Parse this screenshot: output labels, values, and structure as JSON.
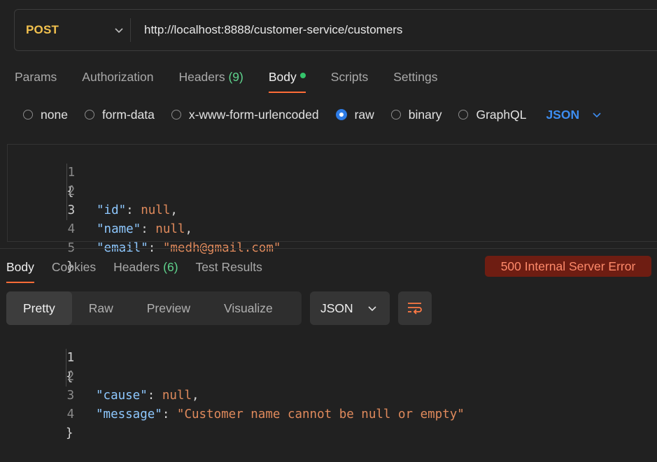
{
  "request": {
    "method": "POST",
    "url": "http://localhost:8888/customer-service/customers",
    "tabs": [
      {
        "label": "Params"
      },
      {
        "label": "Authorization"
      },
      {
        "label": "Headers",
        "count": "(9)"
      },
      {
        "label": "Body",
        "active": true
      },
      {
        "label": "Scripts"
      },
      {
        "label": "Settings"
      }
    ],
    "body_types": [
      "none",
      "form-data",
      "x-www-form-urlencoded",
      "raw",
      "binary",
      "GraphQL"
    ],
    "selected_body_type": "raw",
    "format": "JSON",
    "code_lines": [
      {
        "n": "1",
        "text": "{"
      },
      {
        "n": "2",
        "key": "\"id\"",
        "value": "null",
        "trail": ","
      },
      {
        "n": "3",
        "key": "\"name\"",
        "value": "null",
        "trail": ","
      },
      {
        "n": "4",
        "key": "\"email\"",
        "value": "\"medh@gmail.com\"",
        "trail": ""
      },
      {
        "n": "5",
        "text": "}"
      }
    ]
  },
  "response": {
    "tabs": [
      {
        "label": "Body",
        "active": true
      },
      {
        "label": "Cookies"
      },
      {
        "label": "Headers",
        "count": "(6)"
      },
      {
        "label": "Test Results"
      }
    ],
    "status": "500 Internal Server Error",
    "status_color": "#ff8a6a",
    "view_modes": [
      "Pretty",
      "Raw",
      "Preview",
      "Visualize"
    ],
    "active_view": "Pretty",
    "format": "JSON",
    "code_lines": [
      {
        "n": "1",
        "text": "{"
      },
      {
        "n": "2",
        "key": "\"cause\"",
        "value": "null",
        "trail": ","
      },
      {
        "n": "3",
        "key": "\"message\"",
        "value": "\"Customer name cannot be null or empty\"",
        "trail": ""
      },
      {
        "n": "4",
        "text": "}"
      }
    ]
  },
  "colors": {
    "method": "#f2c14e",
    "accent_tab": "#ff6c37",
    "radio_checked": "#2d7be5",
    "json_key": "#8ec8ff",
    "json_value": "#e08a5c",
    "status_bg": "#6e1d12"
  }
}
